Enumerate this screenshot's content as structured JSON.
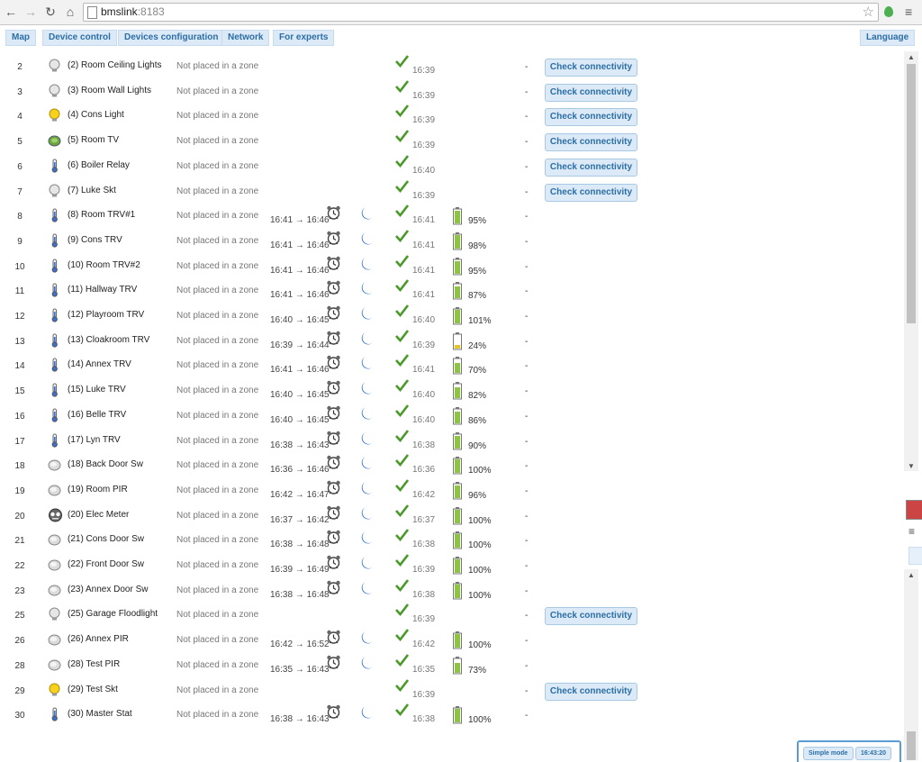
{
  "browser": {
    "url_host": "bmslink",
    "url_port": ":8183"
  },
  "nav": {
    "tabs": [
      "Map",
      "Device control",
      "Devices configuration",
      "Network",
      "For experts"
    ],
    "language": "Language"
  },
  "button_label": "Check connectivity",
  "devices": [
    {
      "num": "2",
      "icon": "bulb",
      "name": "(2) Room Ceiling Lights",
      "zone": "Not placed in a zone",
      "sched": "",
      "clock": false,
      "moon": false,
      "time": "16:39",
      "batt": null,
      "pct": "",
      "dash": "-",
      "button": true
    },
    {
      "num": "3",
      "icon": "bulb",
      "name": "(3) Room Wall Lights",
      "zone": "Not placed in a zone",
      "sched": "",
      "clock": false,
      "moon": false,
      "time": "16:39",
      "batt": null,
      "pct": "",
      "dash": "-",
      "button": true
    },
    {
      "num": "4",
      "icon": "bulb-on",
      "name": "(4) Cons Light",
      "zone": "Not placed in a zone",
      "sched": "",
      "clock": false,
      "moon": false,
      "time": "16:39",
      "batt": null,
      "pct": "",
      "dash": "-",
      "button": true
    },
    {
      "num": "5",
      "icon": "tv",
      "name": "(5) Room TV",
      "zone": "Not placed in a zone",
      "sched": "",
      "clock": false,
      "moon": false,
      "time": "16:39",
      "batt": null,
      "pct": "",
      "dash": "-",
      "button": true
    },
    {
      "num": "6",
      "icon": "thermo",
      "name": "(6) Boiler Relay",
      "zone": "Not placed in a zone",
      "sched": "",
      "clock": false,
      "moon": false,
      "time": "16:40",
      "batt": null,
      "pct": "",
      "dash": "-",
      "button": true
    },
    {
      "num": "7",
      "icon": "bulb",
      "name": "(7) Luke Skt",
      "zone": "Not placed in a zone",
      "sched": "",
      "clock": false,
      "moon": false,
      "time": "16:39",
      "batt": null,
      "pct": "",
      "dash": "-",
      "button": true
    },
    {
      "num": "8",
      "icon": "thermo",
      "name": "(8) Room TRV#1",
      "zone": "Not placed in a zone",
      "sched": "16:41 → 16:46",
      "clock": true,
      "moon": true,
      "time": "16:41",
      "batt": 0.95,
      "pct": "95%",
      "dash": "-",
      "button": false
    },
    {
      "num": "9",
      "icon": "thermo",
      "name": "(9) Cons TRV",
      "zone": "Not placed in a zone",
      "sched": "16:41 → 16:46",
      "clock": true,
      "moon": true,
      "time": "16:41",
      "batt": 0.98,
      "pct": "98%",
      "dash": "-",
      "button": false
    },
    {
      "num": "10",
      "icon": "thermo",
      "name": "(10) Room TRV#2",
      "zone": "Not placed in a zone",
      "sched": "16:41 → 16:46",
      "clock": true,
      "moon": true,
      "time": "16:41",
      "batt": 0.95,
      "pct": "95%",
      "dash": "-",
      "button": false
    },
    {
      "num": "11",
      "icon": "thermo",
      "name": "(11) Hallway TRV",
      "zone": "Not placed in a zone",
      "sched": "16:41 → 16:46",
      "clock": true,
      "moon": true,
      "time": "16:41",
      "batt": 0.87,
      "pct": "87%",
      "dash": "-",
      "button": false
    },
    {
      "num": "12",
      "icon": "thermo",
      "name": "(12) Playroom TRV",
      "zone": "Not placed in a zone",
      "sched": "16:40 → 16:45",
      "clock": true,
      "moon": true,
      "time": "16:40",
      "batt": 1.0,
      "pct": "101%",
      "dash": "-",
      "button": false
    },
    {
      "num": "13",
      "icon": "thermo",
      "name": "(13) Cloakroom TRV",
      "zone": "Not placed in a zone",
      "sched": "16:39 → 16:44",
      "clock": true,
      "moon": true,
      "time": "16:39",
      "batt": 0.24,
      "pct": "24%",
      "dash": "-",
      "button": false
    },
    {
      "num": "14",
      "icon": "thermo",
      "name": "(14) Annex TRV",
      "zone": "Not placed in a zone",
      "sched": "16:41 → 16:46",
      "clock": true,
      "moon": true,
      "time": "16:41",
      "batt": 0.7,
      "pct": "70%",
      "dash": "-",
      "button": false
    },
    {
      "num": "15",
      "icon": "thermo",
      "name": "(15) Luke TRV",
      "zone": "Not placed in a zone",
      "sched": "16:40 → 16:45",
      "clock": true,
      "moon": true,
      "time": "16:40",
      "batt": 0.82,
      "pct": "82%",
      "dash": "-",
      "button": false
    },
    {
      "num": "16",
      "icon": "thermo",
      "name": "(16) Belle TRV",
      "zone": "Not placed in a zone",
      "sched": "16:40 → 16:45",
      "clock": true,
      "moon": true,
      "time": "16:40",
      "batt": 0.86,
      "pct": "86%",
      "dash": "-",
      "button": false
    },
    {
      "num": "17",
      "icon": "thermo",
      "name": "(17) Lyn TRV",
      "zone": "Not placed in a zone",
      "sched": "16:38 → 16:43",
      "clock": true,
      "moon": true,
      "time": "16:38",
      "batt": 0.9,
      "pct": "90%",
      "dash": "-",
      "button": false
    },
    {
      "num": "18",
      "icon": "sensor",
      "name": "(18) Back Door Sw",
      "zone": "Not placed in a zone",
      "sched": "16:36 → 16:46",
      "clock": true,
      "moon": true,
      "time": "16:36",
      "batt": 1.0,
      "pct": "100%",
      "dash": "-",
      "button": false
    },
    {
      "num": "19",
      "icon": "sensor",
      "name": "(19) Room PIR",
      "zone": "Not placed in a zone",
      "sched": "16:42 → 16:47",
      "clock": true,
      "moon": true,
      "time": "16:42",
      "batt": 0.96,
      "pct": "96%",
      "dash": "-",
      "button": false
    },
    {
      "num": "20",
      "icon": "meter",
      "name": "(20) Elec Meter",
      "zone": "Not placed in a zone",
      "sched": "16:37 → 16:42",
      "clock": true,
      "moon": true,
      "time": "16:37",
      "batt": 1.0,
      "pct": "100%",
      "dash": "-",
      "button": false
    },
    {
      "num": "21",
      "icon": "sensor",
      "name": "(21) Cons Door Sw",
      "zone": "Not placed in a zone",
      "sched": "16:38 → 16:48",
      "clock": true,
      "moon": true,
      "time": "16:38",
      "batt": 1.0,
      "pct": "100%",
      "dash": "-",
      "button": false
    },
    {
      "num": "22",
      "icon": "sensor",
      "name": "(22) Front Door Sw",
      "zone": "Not placed in a zone",
      "sched": "16:39 → 16:49",
      "clock": true,
      "moon": true,
      "time": "16:39",
      "batt": 1.0,
      "pct": "100%",
      "dash": "-",
      "button": false
    },
    {
      "num": "23",
      "icon": "sensor",
      "name": "(23) Annex Door Sw",
      "zone": "Not placed in a zone",
      "sched": "16:38 → 16:48",
      "clock": true,
      "moon": true,
      "time": "16:38",
      "batt": 1.0,
      "pct": "100%",
      "dash": "-",
      "button": false
    },
    {
      "num": "25",
      "icon": "bulb",
      "name": "(25) Garage Floodlight",
      "zone": "Not placed in a zone",
      "sched": "",
      "clock": false,
      "moon": false,
      "time": "16:39",
      "batt": null,
      "pct": "",
      "dash": "-",
      "button": true
    },
    {
      "num": "26",
      "icon": "sensor",
      "name": "(26) Annex PIR",
      "zone": "Not placed in a zone",
      "sched": "16:42 → 16:52",
      "clock": true,
      "moon": true,
      "time": "16:42",
      "batt": 1.0,
      "pct": "100%",
      "dash": "-",
      "button": false
    },
    {
      "num": "28",
      "icon": "sensor",
      "name": "(28) Test PIR",
      "zone": "Not placed in a zone",
      "sched": "16:35 → 16:43",
      "clock": true,
      "moon": true,
      "time": "16:35",
      "batt": 0.73,
      "pct": "73%",
      "dash": "-",
      "button": false
    },
    {
      "num": "29",
      "icon": "bulb-on",
      "name": "(29) Test Skt",
      "zone": "Not placed in a zone",
      "sched": "",
      "clock": false,
      "moon": false,
      "time": "16:39",
      "batt": null,
      "pct": "",
      "dash": "-",
      "button": true
    },
    {
      "num": "30",
      "icon": "thermo",
      "name": "(30) Master Stat",
      "zone": "Not placed in a zone",
      "sched": "16:38 → 16:43",
      "clock": true,
      "moon": true,
      "time": "16:38",
      "batt": 1.0,
      "pct": "100%",
      "dash": "-",
      "button": false
    }
  ],
  "footer": {
    "simple_mode": "Simple mode",
    "clock": "16:43:20"
  },
  "colors": {
    "accent": "#2c6ea6",
    "button_bg": "#dbeaf6",
    "check_green": "#4a9a2a",
    "battery_green": "#8cc63f",
    "battery_yellow": "#e8c51a",
    "moon_blue": "#2f6fd1"
  }
}
